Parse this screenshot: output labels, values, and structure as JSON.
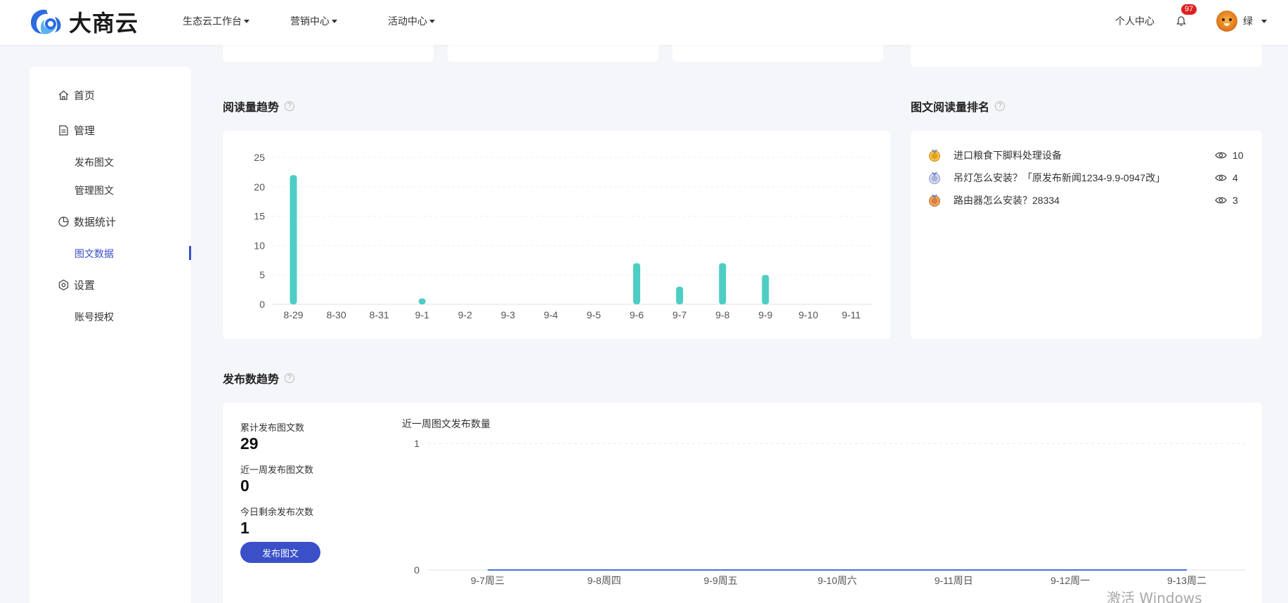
{
  "app": {
    "logo_text": "大商云"
  },
  "topnav": [
    {
      "label": "生态云工作台"
    },
    {
      "label": "营销中心"
    },
    {
      "label": "活动中心"
    }
  ],
  "header": {
    "personal_center": "个人中心",
    "notification_count": "97",
    "username": "绿"
  },
  "sidebar": {
    "home": "首页",
    "manage": "管理",
    "publish_post": "发布图文",
    "manage_posts": "管理图文",
    "data_stats": "数据统计",
    "post_data": "图文数据",
    "settings": "设置",
    "account_auth": "账号授权"
  },
  "read_trend": {
    "title": "阅读量趋势",
    "help": "?"
  },
  "ranking": {
    "title": "图文阅读量排名",
    "help": "?",
    "items": [
      {
        "title": "进口粮食下脚料处理设备",
        "views": "10",
        "medal_color": "#e8a01a"
      },
      {
        "title": "吊灯怎么安装？「原发布新闻1234-9.9-0947改」",
        "views": "4",
        "medal_color": "#8a95c8"
      },
      {
        "title": "路由器怎么安装？28334",
        "views": "3",
        "medal_color": "#d9803a"
      }
    ]
  },
  "publish_trend": {
    "title": "发布数趋势",
    "help": "?",
    "total_label": "累计发布图文数",
    "total_value": "29",
    "week_label": "近一周发布图文数",
    "week_value": "0",
    "today_left_label": "今日剩余发布次数",
    "today_left_value": "1",
    "publish_button": "发布图文",
    "chart_subtitle": "近一周图文发布数量"
  },
  "watermark": "激活 Windows",
  "colors": {
    "accent": "#3a4fc8",
    "bar": "#4ecdc4",
    "line": "#4a6fe0"
  },
  "chart_data": [
    {
      "type": "bar",
      "title": "阅读量趋势",
      "categories": [
        "8-29",
        "8-30",
        "8-31",
        "9-1",
        "9-2",
        "9-3",
        "9-4",
        "9-5",
        "9-6",
        "9-7",
        "9-8",
        "9-9",
        "9-10",
        "9-11"
      ],
      "values": [
        22,
        0,
        0,
        1,
        0,
        0,
        0,
        0,
        7,
        3,
        7,
        5,
        0,
        0
      ],
      "yticks": [
        0,
        5,
        10,
        15,
        20,
        25
      ],
      "ylim": [
        0,
        25
      ],
      "grid": true
    },
    {
      "type": "line",
      "title": "近一周图文发布数量",
      "categories": [
        "9-7周三",
        "9-8周四",
        "9-9周五",
        "9-10周六",
        "9-11周日",
        "9-12周一",
        "9-13周二"
      ],
      "values": [
        0,
        0,
        0,
        0,
        0,
        0,
        0
      ],
      "yticks": [
        0,
        1
      ],
      "ylim": [
        0,
        1
      ],
      "grid": true
    }
  ]
}
